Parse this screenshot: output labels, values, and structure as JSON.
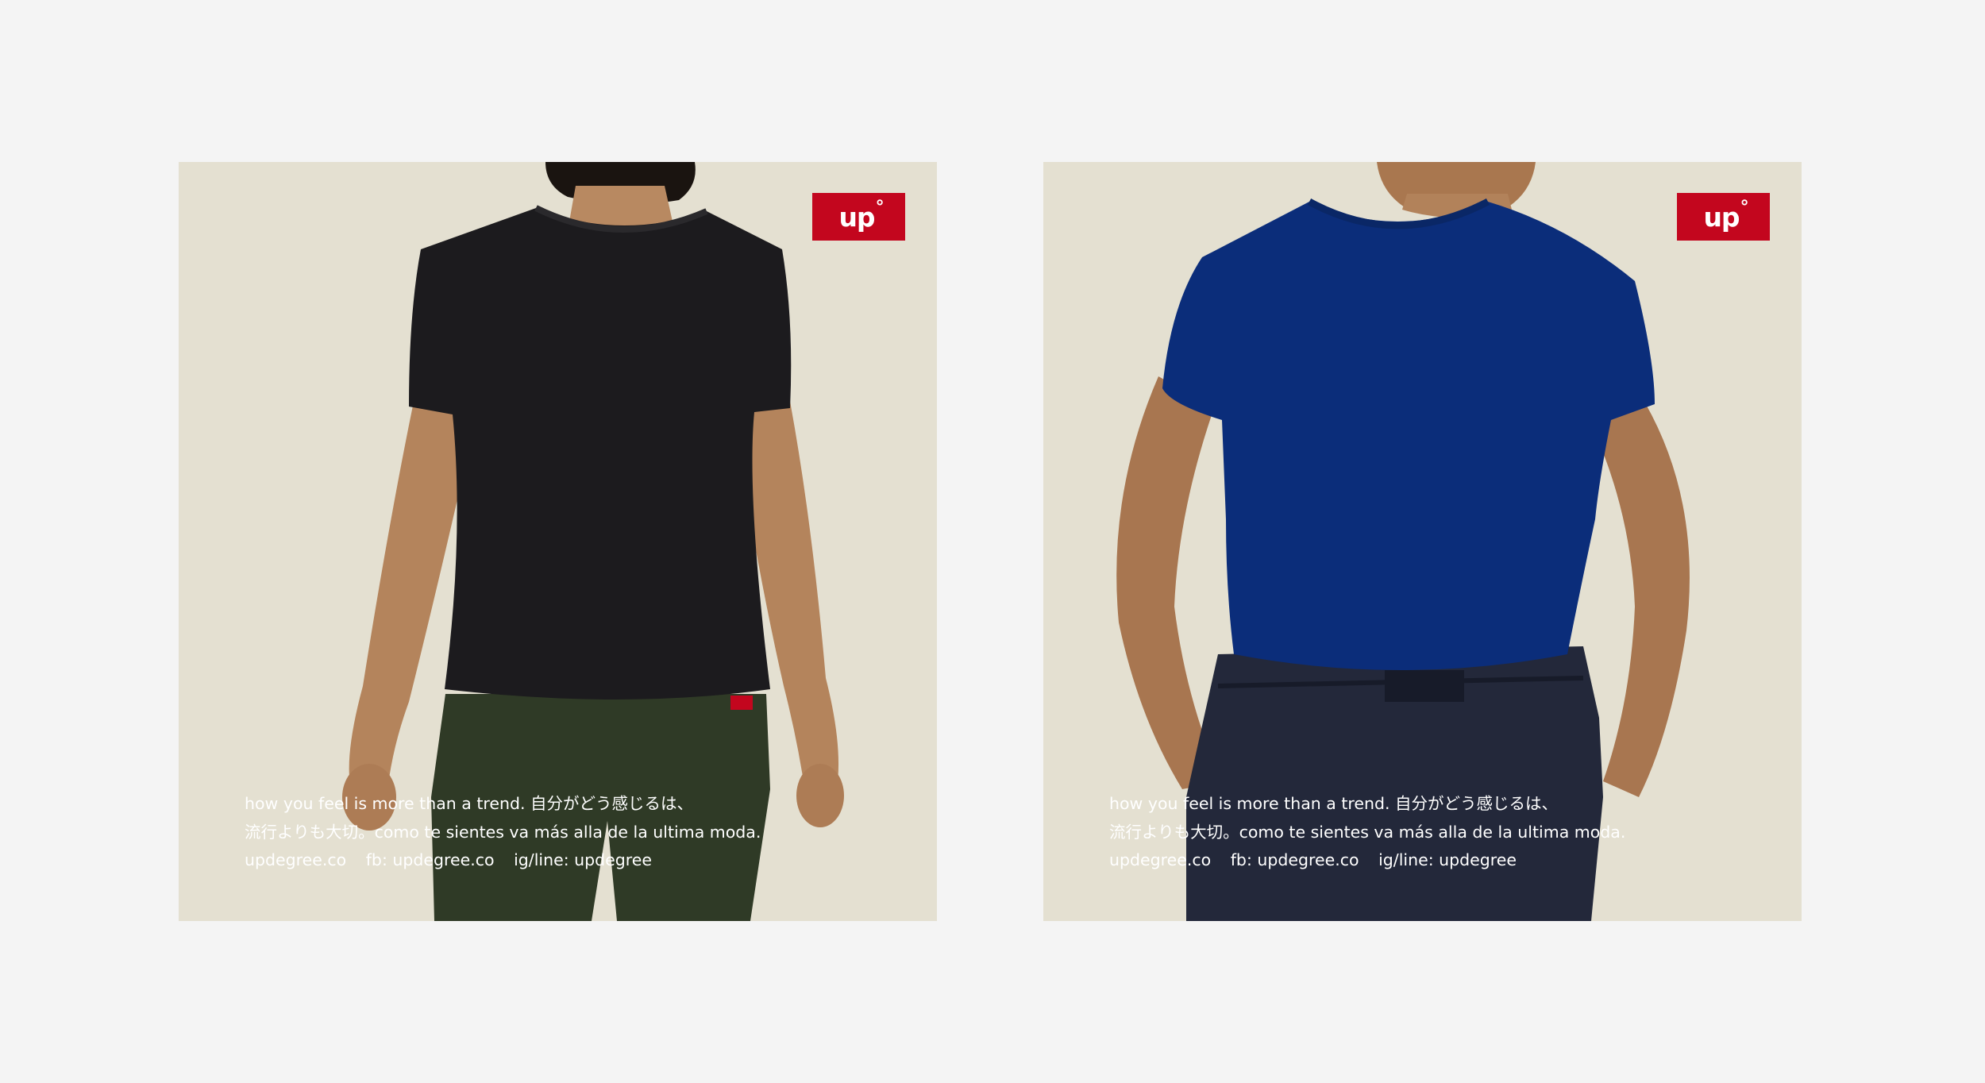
{
  "cards": [
    {
      "logo": {
        "text": "up",
        "degree": "°"
      },
      "caption": {
        "line1": "how you feel is more than a trend. 自分がどう感じるは、",
        "line2": "流行よりも大切。como te sientes va más alla de la ultima moda.",
        "links": [
          "updegree.co",
          "fb: updegree.co",
          "ig/line: updegree"
        ]
      },
      "colors": {
        "shirt": "#1c1b1e",
        "pants": "#2f3a26"
      }
    },
    {
      "logo": {
        "text": "up",
        "degree": "°"
      },
      "caption": {
        "line1": "how you feel is more than a trend. 自分がどう感じるは、",
        "line2": "流行よりも大切。como te sientes va más alla de la ultima moda.",
        "links": [
          "updegree.co",
          "fb: updegree.co",
          "ig/line: updegree"
        ]
      },
      "colors": {
        "shirt": "#0b2d7a",
        "pants": "#23283a"
      }
    }
  ],
  "colors": {
    "page_background": "#f4f4f4",
    "card_background": "#e4e0d1",
    "brand_red": "#c3061e",
    "caption_text": "#ffffff",
    "skin": "#b7865f"
  }
}
